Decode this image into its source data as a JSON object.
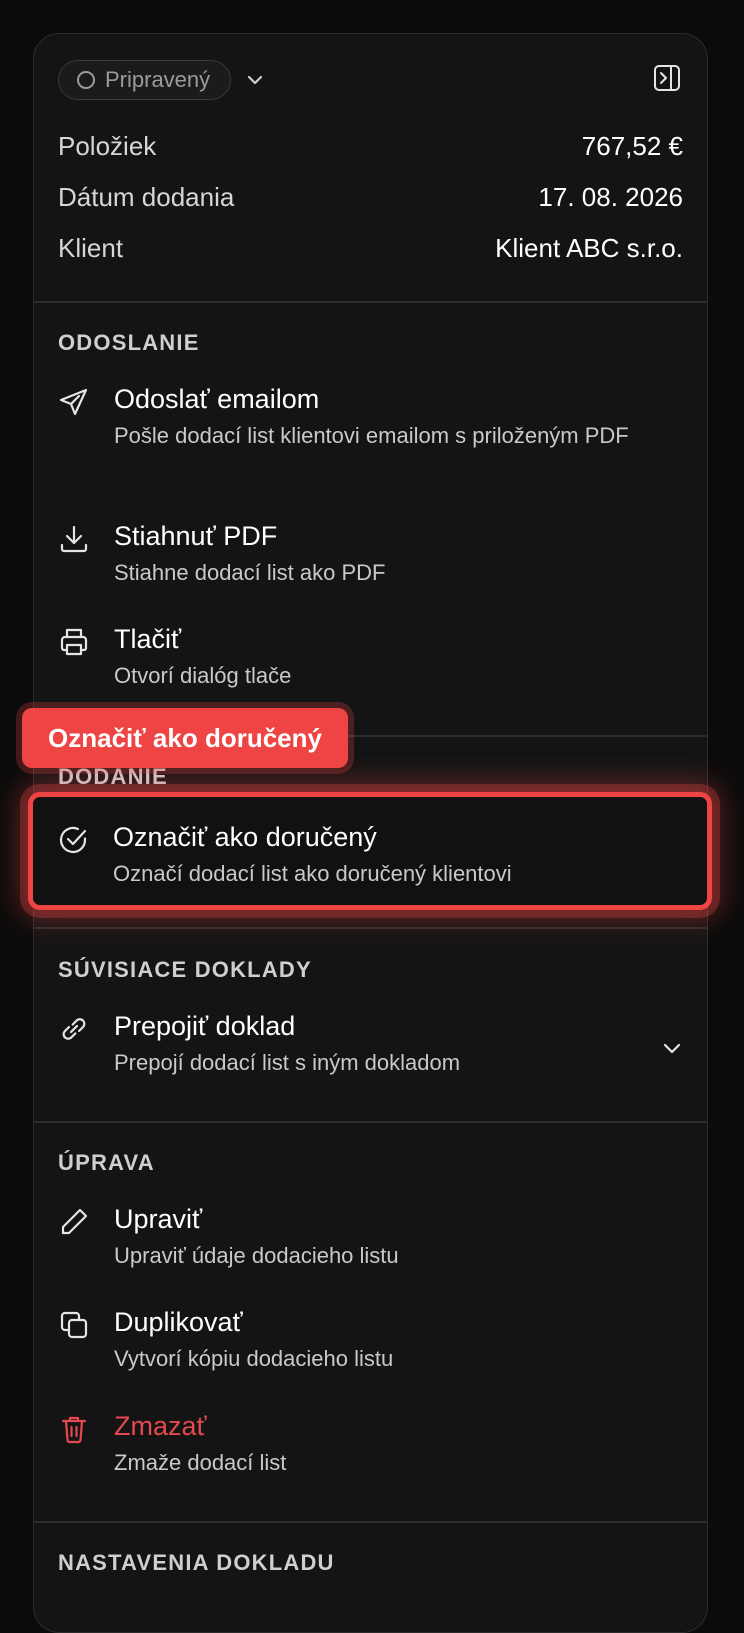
{
  "status": {
    "label": "Pripravený"
  },
  "summary": [
    {
      "label": "Položiek",
      "value": "767,52 €"
    },
    {
      "label": "Dátum dodania",
      "value": "17. 08. 2026"
    },
    {
      "label": "Klient",
      "value": "Klient ABC s.r.o."
    }
  ],
  "sections": {
    "odoslanie": {
      "title": "ODOSLANIE",
      "actions": [
        {
          "title": "Odoslať emailom",
          "desc": "Pošle dodací list klientovi emailom s priloženým PDF",
          "icon": "send-icon"
        },
        {
          "title": "Stiahnuť PDF",
          "desc": "Stiahne dodací list ako PDF",
          "icon": "download-icon"
        },
        {
          "title": "Tlačiť",
          "desc": "Otvorí dialóg tlače",
          "icon": "printer-icon"
        }
      ]
    },
    "dodanie": {
      "title": "DODANIE",
      "actions": [
        {
          "title": "Označiť ako doručený",
          "desc": "Označí dodací list ako doručený klientovi",
          "icon": "check-circle-icon"
        }
      ]
    },
    "suvisiace": {
      "title": "SÚVISIACE DOKLADY",
      "actions": [
        {
          "title": "Prepojiť doklad",
          "desc": "Prepojí dodací list s iným dokladom",
          "icon": "link-icon"
        }
      ]
    },
    "uprava": {
      "title": "ÚPRAVA",
      "actions": [
        {
          "title": "Upraviť",
          "desc": "Upraviť údaje dodacieho listu",
          "icon": "pencil-icon"
        },
        {
          "title": "Duplikovať",
          "desc": "Vytvorí kópiu dodacieho listu",
          "icon": "copy-icon"
        },
        {
          "title": "Zmazať",
          "desc": "Zmaže dodací list",
          "icon": "trash-icon",
          "color": "#e5484d"
        }
      ]
    },
    "nastavenia": {
      "title": "NASTAVENIA DOKLADU"
    }
  },
  "tooltip": {
    "label": "Označiť ako doručený"
  },
  "colors": {
    "accent": "#ef4444",
    "danger": "#e5484d",
    "panel": "#141414",
    "background": "#0b0b0b"
  }
}
